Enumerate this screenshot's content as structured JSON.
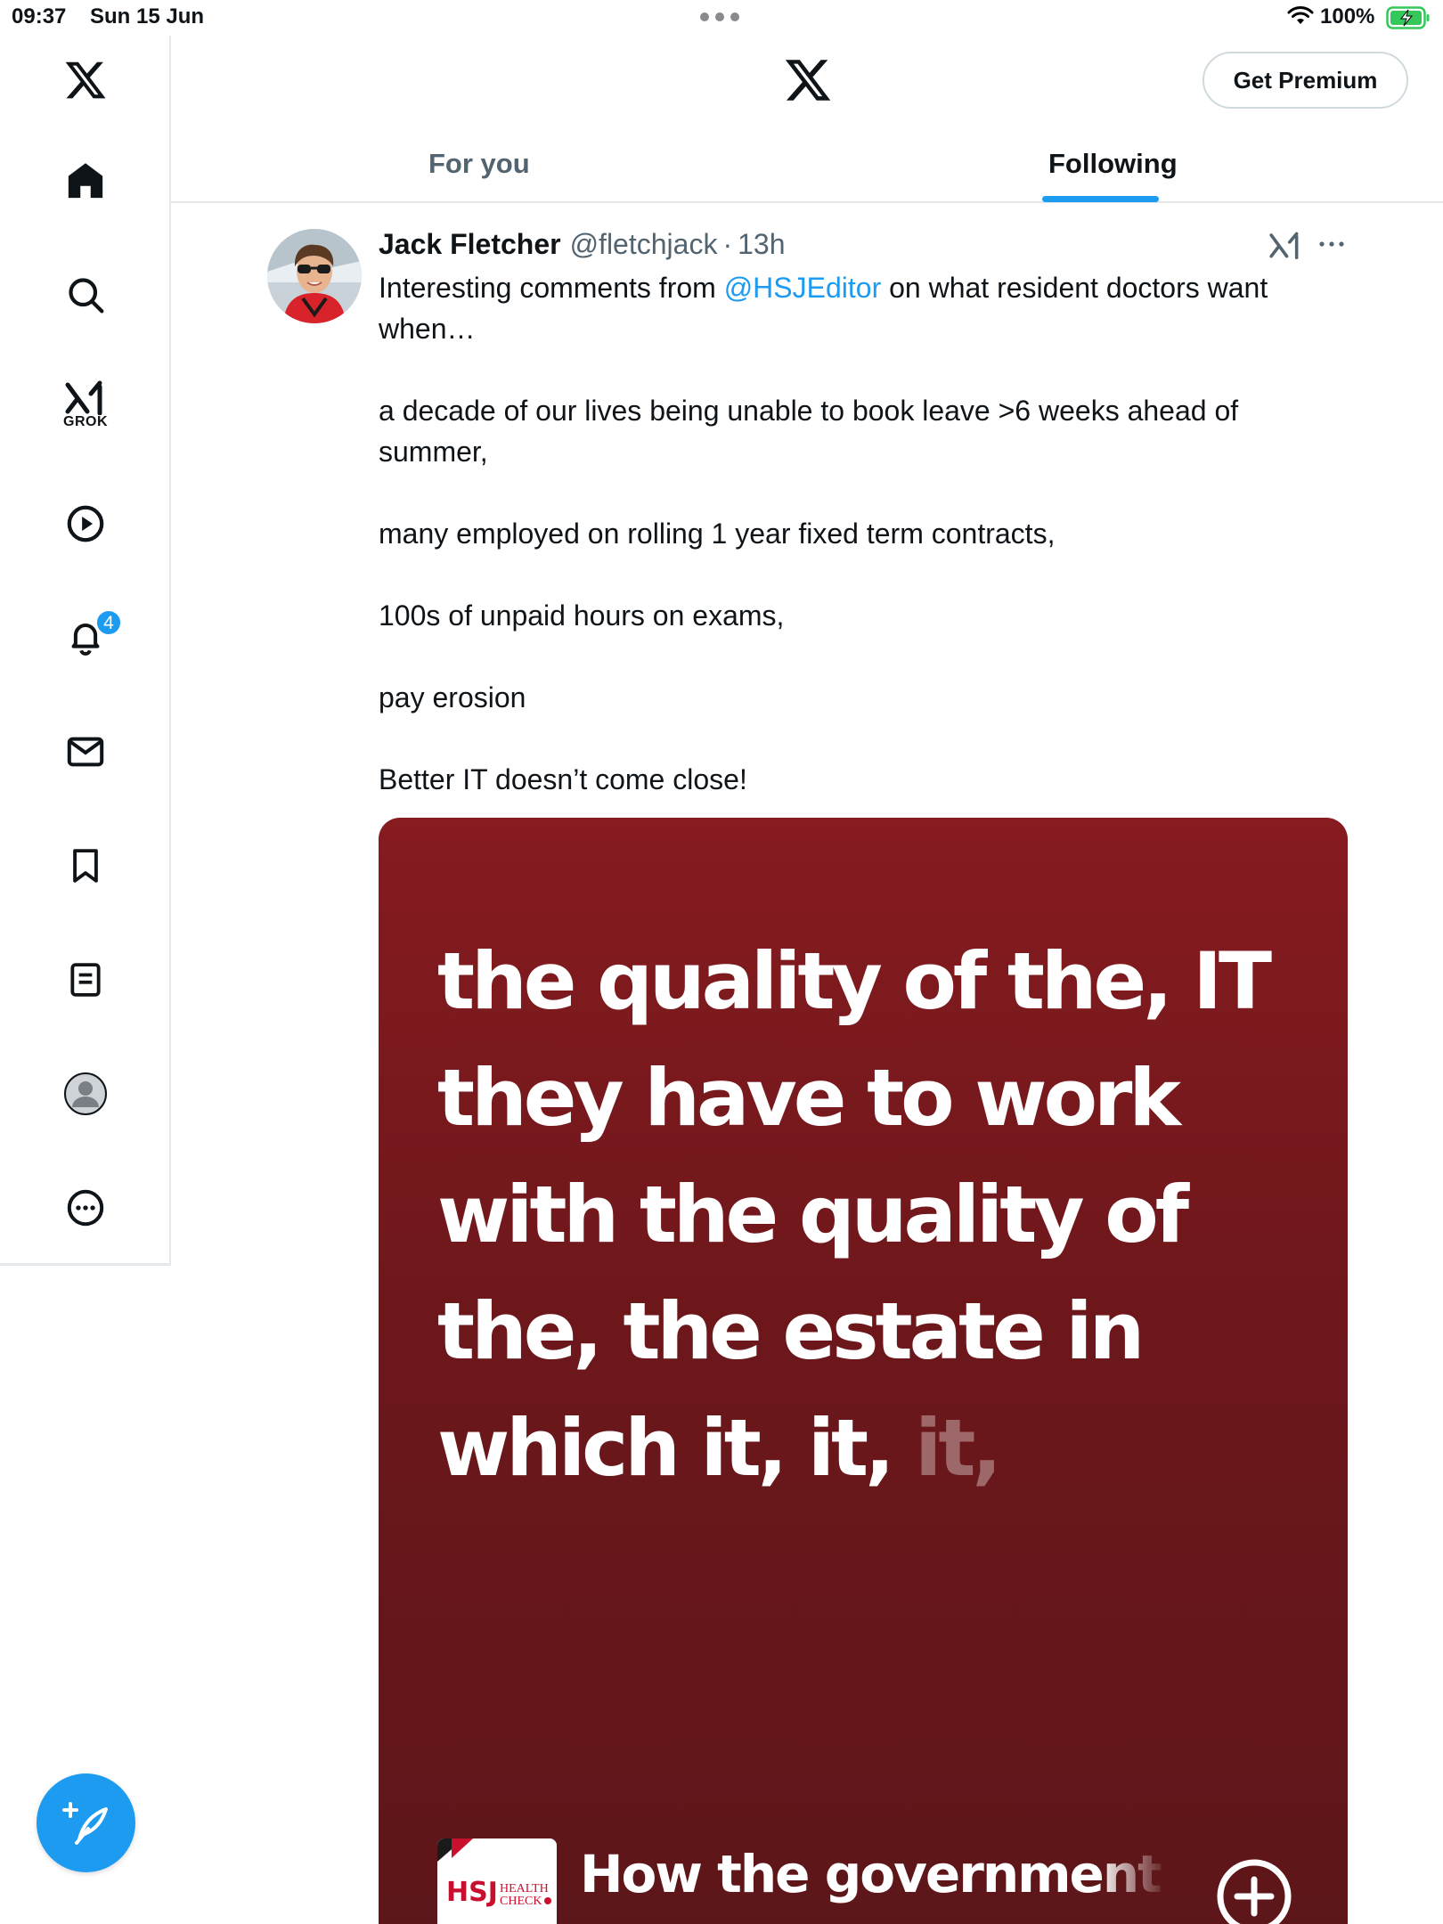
{
  "status_bar": {
    "time": "09:37",
    "date": "Sun 15 Jun",
    "battery_percent": "100%"
  },
  "sidebar": {
    "items": [
      {
        "name": "x-logo-icon"
      },
      {
        "name": "home-icon"
      },
      {
        "name": "search-icon"
      },
      {
        "name": "grok-icon",
        "label": "GROK"
      },
      {
        "name": "video-icon"
      },
      {
        "name": "notifications-icon",
        "badge": "4"
      },
      {
        "name": "messages-icon"
      },
      {
        "name": "bookmarks-icon"
      },
      {
        "name": "lists-icon"
      },
      {
        "name": "profile-icon"
      },
      {
        "name": "more-icon"
      }
    ],
    "compose_icon": "compose-feather-icon"
  },
  "header": {
    "premium_label": "Get Premium",
    "tabs": [
      {
        "label": "For you",
        "selected": false
      },
      {
        "label": "Following",
        "selected": true
      }
    ],
    "accent_color": "#1d9bf0"
  },
  "tweet": {
    "author_name": "Jack Fletcher",
    "author_handle": "@fletchjack",
    "separator": "·",
    "time": "13h",
    "text_intro": "Interesting comments from ",
    "mention": "@HSJEditor",
    "text_intro_rest": " on what resident doctors want when…",
    "paragraphs": [
      "a decade of our lives being unable to book leave >6 weeks ahead of summer,",
      "many employed on rolling 1 year fixed term contracts,",
      "100s of unpaid hours on exams,",
      "pay erosion",
      "Better IT doesn’t come close!"
    ],
    "media": {
      "quote_main": "the quality of the, IT they have to work with the quality of the, the estate in which it, it, ",
      "quote_faded": "it,",
      "caption": "How the government sh",
      "logo_text": "HSJ",
      "logo_subtext": "HEALTH CHECK",
      "background_color": "#7a1a1e"
    }
  }
}
